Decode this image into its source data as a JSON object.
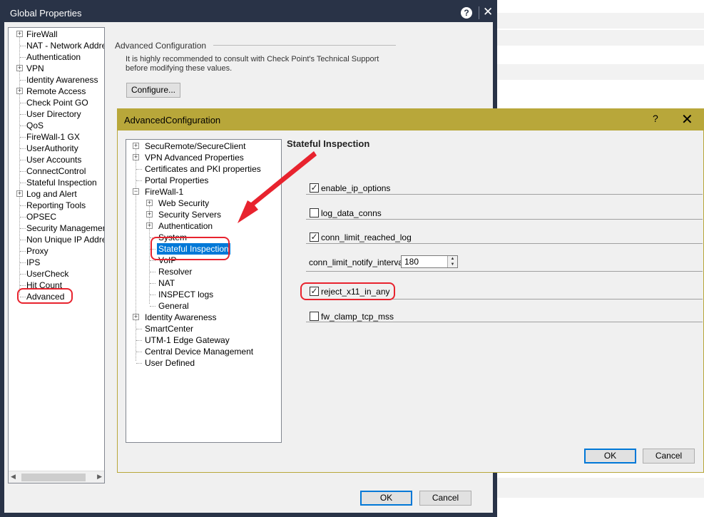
{
  "global_properties": {
    "title": "Global Properties",
    "help_icon": "question-circle-icon",
    "tree": [
      {
        "label": "FireWall",
        "expander": true
      },
      {
        "label": "NAT - Network Address Translation",
        "expander": false
      },
      {
        "label": "Authentication",
        "expander": false
      },
      {
        "label": "VPN",
        "expander": true
      },
      {
        "label": "Identity Awareness",
        "expander": false
      },
      {
        "label": "Remote Access",
        "expander": true
      },
      {
        "label": "Check Point GO",
        "expander": false
      },
      {
        "label": "User Directory",
        "expander": false
      },
      {
        "label": "QoS",
        "expander": false
      },
      {
        "label": "FireWall-1 GX",
        "expander": false
      },
      {
        "label": "UserAuthority",
        "expander": false
      },
      {
        "label": "User Accounts",
        "expander": false
      },
      {
        "label": "ConnectControl",
        "expander": false
      },
      {
        "label": "Stateful Inspection",
        "expander": false
      },
      {
        "label": "Log and Alert",
        "expander": true
      },
      {
        "label": "Reporting Tools",
        "expander": false
      },
      {
        "label": "OPSEC",
        "expander": false
      },
      {
        "label": "Security Management Access",
        "expander": false
      },
      {
        "label": "Non Unique IP Address Ranges",
        "expander": false
      },
      {
        "label": "Proxy",
        "expander": false
      },
      {
        "label": "IPS",
        "expander": false
      },
      {
        "label": "UserCheck",
        "expander": false
      },
      {
        "label": "Hit Count",
        "expander": false
      },
      {
        "label": "Advanced",
        "expander": false
      }
    ],
    "advanced_config": {
      "heading": "Advanced Configuration",
      "line1": "It is highly recommended to consult with Check Point's Technical Support",
      "line2": "before modifying these values.",
      "configure_button": "Configure..."
    },
    "ok_button": "OK",
    "cancel_button": "Cancel"
  },
  "advanced_configuration_dialog": {
    "title": "AdvancedConfiguration",
    "help_glyph": "?",
    "tree": [
      {
        "label": "SecuRemote/SecureClient",
        "expander": true,
        "level": 0
      },
      {
        "label": "VPN Advanced Properties",
        "expander": true,
        "level": 0
      },
      {
        "label": "Certificates and PKI properties",
        "expander": false,
        "level": 0
      },
      {
        "label": "Portal Properties",
        "expander": false,
        "level": 0
      },
      {
        "label": "FireWall-1",
        "expander": "open",
        "level": 0
      },
      {
        "label": "Web Security",
        "expander": true,
        "level": 1
      },
      {
        "label": "Security Servers",
        "expander": true,
        "level": 1
      },
      {
        "label": "Authentication",
        "expander": true,
        "level": 1
      },
      {
        "label": "System",
        "expander": false,
        "level": 1
      },
      {
        "label": "Stateful Inspection",
        "expander": false,
        "level": 1,
        "selected": true
      },
      {
        "label": "VoIP",
        "expander": false,
        "level": 1
      },
      {
        "label": "Resolver",
        "expander": false,
        "level": 1
      },
      {
        "label": "NAT",
        "expander": false,
        "level": 1
      },
      {
        "label": "INSPECT logs",
        "expander": false,
        "level": 1
      },
      {
        "label": "General",
        "expander": false,
        "level": 1
      },
      {
        "label": "Identity Awareness",
        "expander": true,
        "level": 0
      },
      {
        "label": "SmartCenter",
        "expander": false,
        "level": 0
      },
      {
        "label": "UTM-1 Edge Gateway",
        "expander": false,
        "level": 0
      },
      {
        "label": "Central Device Management",
        "expander": false,
        "level": 0
      },
      {
        "label": "User Defined",
        "expander": false,
        "level": 0
      }
    ],
    "section_title": "Stateful Inspection",
    "options": {
      "enable_ip_options": {
        "label": "enable_ip_options",
        "checked": true
      },
      "log_data_conns": {
        "label": "log_data_conns",
        "checked": false
      },
      "conn_limit_reached_log": {
        "label": "conn_limit_reached_log",
        "checked": true
      },
      "conn_limit_notify_interval": {
        "label": "conn_limit_notify_interval",
        "value": "180"
      },
      "reject_x11_in_any": {
        "label": "reject_x11_in_any",
        "checked": true
      },
      "fw_clamp_tcp_mss": {
        "label": "fw_clamp_tcp_mss",
        "checked": false
      }
    },
    "ok_button": "OK",
    "cancel_button": "Cancel"
  },
  "colors": {
    "global_titlebar": "#293347",
    "dialog_titlebar": "#b8a73a",
    "selection": "#0078d7",
    "annotation_red": "#e8232e"
  }
}
